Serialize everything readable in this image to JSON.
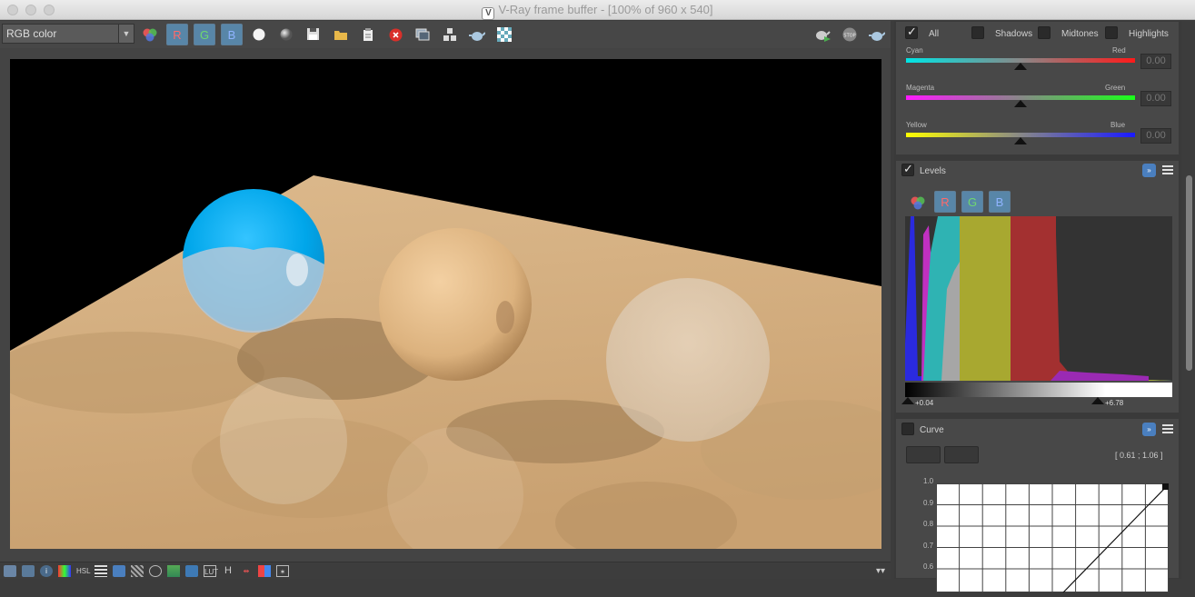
{
  "window": {
    "title": "V-Ray frame buffer - [100% of 960 x 540]"
  },
  "toolbar": {
    "channel_value": "RGB color",
    "r_label": "R",
    "g_label": "G",
    "b_label": "B"
  },
  "color_balance": {
    "all_label": "All",
    "all_checked": true,
    "shadows_label": "Shadows",
    "midtones_label": "Midtones",
    "highlights_label": "Highlights",
    "sliders": [
      {
        "left": "Cyan",
        "right": "Red",
        "value": "0.00",
        "from": "#00e5e5",
        "to": "#ff1a1a"
      },
      {
        "left": "Magenta",
        "right": "Green",
        "value": "0.00",
        "from": "#ff1aff",
        "to": "#1aff1a"
      },
      {
        "left": "Yellow",
        "right": "Blue",
        "value": "0.00",
        "from": "#ffff00",
        "to": "#1a1aff"
      }
    ]
  },
  "levels": {
    "label": "Levels",
    "checked": true,
    "r_label": "R",
    "g_label": "G",
    "b_label": "B",
    "low_value": "+0.04",
    "high_value": "+6.78"
  },
  "curve": {
    "label": "Curve",
    "checked": false,
    "coords": "[ 0.61 ; 1.06 ]",
    "y_ticks": [
      "1.0",
      "0.9",
      "0.8",
      "0.7",
      "0.6"
    ]
  },
  "colors": {
    "accent": "#5886a8",
    "sphere_blue": "#00aaee",
    "floor": "#d9b68a"
  }
}
